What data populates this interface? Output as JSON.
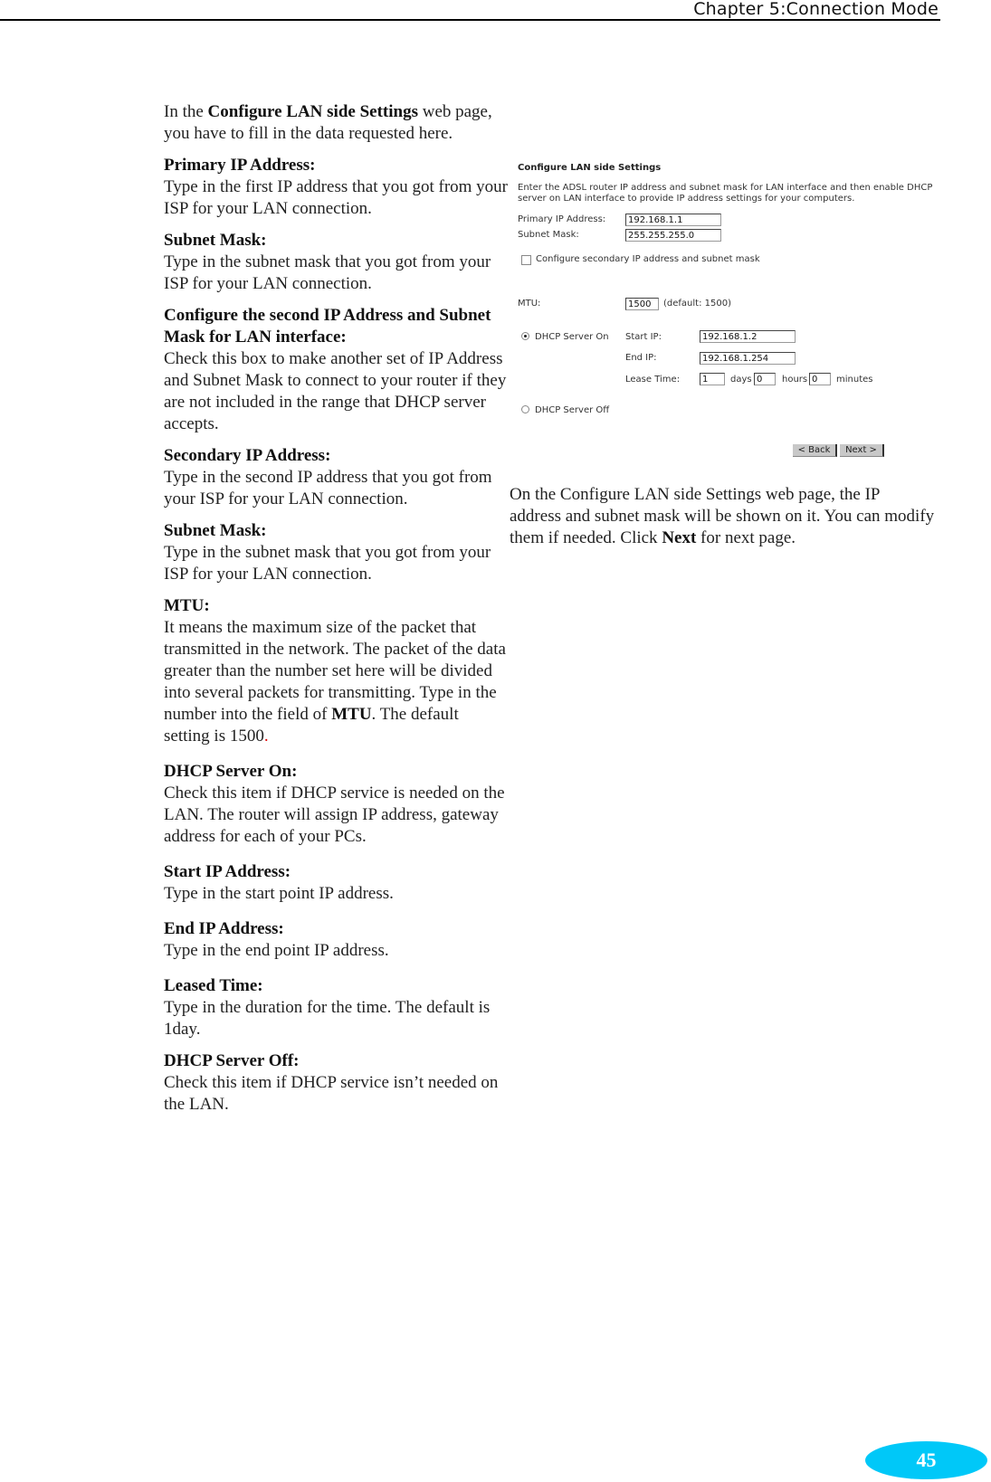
{
  "header": {
    "chapter_title": "Chapter 5:Connection Mode"
  },
  "left": {
    "intro_pre": "In the ",
    "intro_bold": "Configure LAN side Settings",
    "intro_post": " web page, you have to fill in the data requested here.",
    "sections": [
      {
        "title": "Primary IP Address:",
        "body": "Type in the first IP address that you got from your ISP for your LAN connection."
      },
      {
        "title": "Subnet Mask:",
        "body": "Type in the subnet mask that you got from your ISP for your LAN connection."
      },
      {
        "title": "Configure the second IP Address and Subnet Mask for LAN interface:",
        "body": "Check this box to make another set of IP Address and Subnet Mask to connect to your router if they are not included in the range that DHCP server accepts."
      },
      {
        "title": "Secondary IP Address:",
        "body": "Type in the second IP address that you got from your ISP for your LAN connection."
      },
      {
        "title": "Subnet Mask:",
        "body": "Type in the subnet mask that you got from your ISP for your LAN connection."
      },
      {
        "title": "MTU:",
        "body_pre": "It means the maximum size of the packet that transmitted in the network. The packet of the data greater than the number set here will be divided into several packets for transmitting. Type in the number into the field of ",
        "body_bold": "MTU",
        "body_post": ". The default setting is 1500",
        "body_red": "."
      },
      {
        "title": "DHCP Server On:",
        "body": "Check this item if DHCP service is needed on the LAN. The router will assign IP address, gateway address for each of your PCs."
      },
      {
        "title": "Start IP Address:",
        "body": "Type in the start point IP address."
      },
      {
        "title": "End IP Address:",
        "body": "Type in the end point IP address."
      },
      {
        "title": "Leased Time:",
        "body": "Type in the duration for the time. The default is 1day."
      },
      {
        "title": "DHCP Server Off:",
        "body": "Check this item if DHCP service isn’t needed on the LAN."
      }
    ]
  },
  "screenshot": {
    "title": "Configure LAN side Settings",
    "description": "Enter the ADSL router IP address and subnet mask for LAN interface and then enable DHCP server on LAN interface to provide IP address settings for your computers.",
    "primary_ip_label": "Primary IP Address:",
    "primary_ip_value": "192.168.1.1",
    "subnet_mask_label": "Subnet Mask:",
    "subnet_mask_value": "255.255.255.0",
    "secondary_checkbox_label": "Configure secondary IP address and subnet mask",
    "mtu_label": "MTU:",
    "mtu_value": "1500",
    "mtu_default": "(default: 1500)",
    "dhcp_on_label": "DHCP Server On",
    "start_ip_label": "Start IP:",
    "start_ip_value": "192.168.1.2",
    "end_ip_label": "End IP:",
    "end_ip_value": "192.168.1.254",
    "lease_time_label": "Lease Time:",
    "lease_days_value": "1",
    "days_label": "days",
    "lease_hours_value": "0",
    "hours_label": "hours",
    "lease_minutes_value": "0",
    "minutes_label": "minutes",
    "dhcp_off_label": "DHCP Server Off",
    "back_button": "< Back",
    "next_button": "Next >"
  },
  "caption": {
    "pre": "On the Configure LAN side Settings web page, the IP address and subnet mask will be shown on it. You can modify them if needed. Click ",
    "bold": "Next",
    "post": " for next page."
  },
  "footer": {
    "page_number": "45",
    "badge_color": "#00c8f8"
  }
}
